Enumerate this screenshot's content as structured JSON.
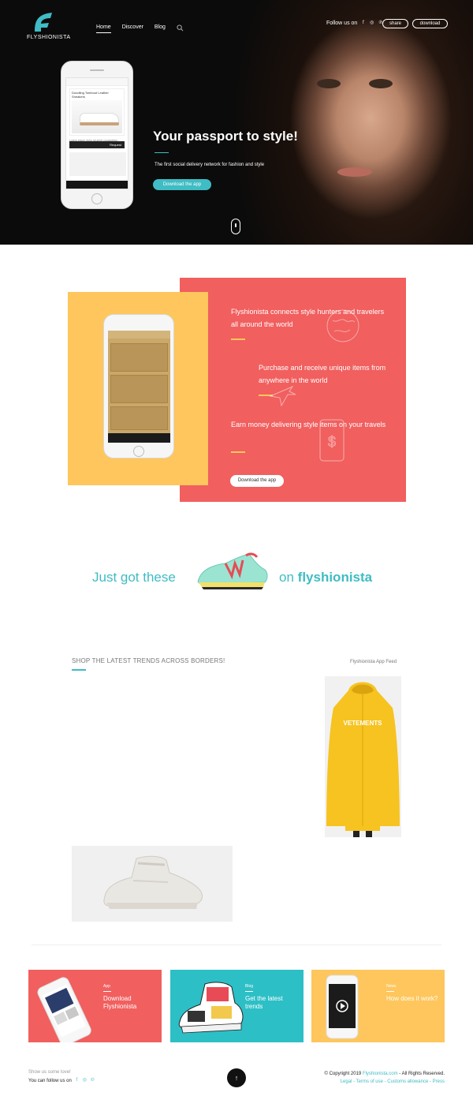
{
  "header": {
    "logo_text": "FLYSHIONISTA",
    "nav": [
      "Home",
      "Discover",
      "Blog"
    ],
    "follow_label": "Follow us on",
    "share_label": "share",
    "download_label": "download"
  },
  "hero": {
    "title": "Your passport to style!",
    "subtitle": "The first social delivery network for fashion and style",
    "cta": "Download the app",
    "phone_card_title": "Doodling Tomboot Leather Sneakers",
    "phone_card_text": "Lorem ipsum dolor sit amet consectetur adipiscing elit sed do eiusmod",
    "phone_card_button": "Request"
  },
  "features": {
    "item1": "Flyshionista connects style hunters and travelers all around the world",
    "item2": "Purchase and receive unique items from anywhere in the world",
    "item3": "Earn money delivering style items on your travels",
    "cta": "Download the app"
  },
  "slogan": {
    "left": "Just got these",
    "right_prefix": "on",
    "right_brand": "flyshionista"
  },
  "trends": {
    "title": "SHOP THE LATEST TRENDS ACROSS BORDERS!",
    "feed_label": "Flyshionista App Feed",
    "coat_text": "VETEMENTS"
  },
  "cards": [
    {
      "kicker": "App",
      "title": "Download Flyshionista",
      "color": "#f15f5f"
    },
    {
      "kicker": "Blog",
      "title": "Get the latest trends",
      "color": "#2dbfc6"
    },
    {
      "kicker": "News",
      "title": "How does it work?",
      "color": "#fec65c"
    }
  ],
  "footer": {
    "love": "Show us some love!",
    "follow": "You can follow us on",
    "copyright_prefix": "© Copyright 2019",
    "copyright_link": "Flyshionista.com",
    "copyright_suffix": "- All Rights Reserved.",
    "links": "Legal - Terms of use - Customs allowance - Press"
  }
}
